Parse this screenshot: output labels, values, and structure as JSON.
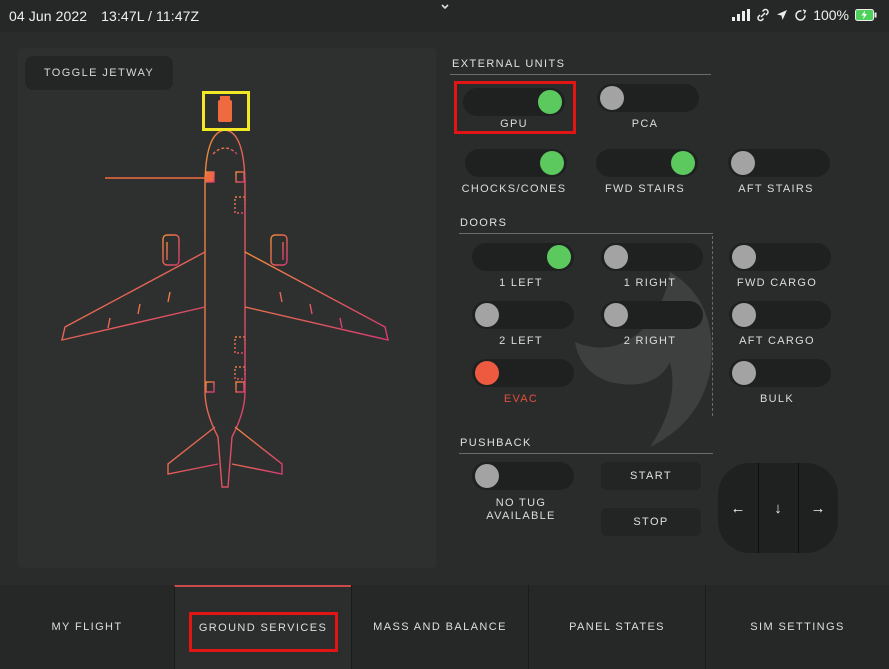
{
  "status_bar": {
    "date": "04 Jun 2022",
    "time": "13:47L / 11:47Z",
    "battery": "100%",
    "icons": [
      "cellular-signal-icon",
      "link-icon",
      "location-arrow-icon",
      "sync-icon",
      "battery-charging-icon"
    ]
  },
  "jetway": {
    "button_label": "TOGGLE JETWAY"
  },
  "external_units": {
    "title": "EXTERNAL UNITS",
    "items": [
      {
        "label": "GPU",
        "state": "on"
      },
      {
        "label": "PCA",
        "state": "off"
      },
      {
        "label": "CHOCKS/CONES",
        "state": "on"
      },
      {
        "label": "FWD STAIRS",
        "state": "on"
      },
      {
        "label": "AFT STAIRS",
        "state": "off"
      }
    ]
  },
  "doors": {
    "title": "DOORS",
    "items": [
      {
        "label": "1 LEFT",
        "state": "on"
      },
      {
        "label": "1 RIGHT",
        "state": "off"
      },
      {
        "label": "FWD CARGO",
        "state": "off"
      },
      {
        "label": "2 LEFT",
        "state": "off"
      },
      {
        "label": "2 RIGHT",
        "state": "off"
      },
      {
        "label": "AFT CARGO",
        "state": "off"
      },
      {
        "label": "EVAC",
        "state": "alert"
      },
      {
        "label": "BULK",
        "state": "off"
      }
    ]
  },
  "pushback": {
    "title": "PUSHBACK",
    "tug_label_line1": "NO TUG",
    "tug_label_line2": "AVAILABLE",
    "tug_state": "off",
    "start_label": "START",
    "stop_label": "STOP",
    "left_arrow": "←",
    "down_arrow": "↓",
    "right_arrow": "→"
  },
  "tabs": [
    {
      "label": "MY FLIGHT",
      "active": false
    },
    {
      "label": "GROUND SERVICES",
      "active": true
    },
    {
      "label": "MASS AND BALANCE",
      "active": false
    },
    {
      "label": "PANEL STATES",
      "active": false
    },
    {
      "label": "SIM SETTINGS",
      "active": false
    }
  ],
  "colors": {
    "on": "#5cc95e",
    "off": "#a3a3a3",
    "evac": "#ee5a40",
    "highlight_red": "#e21414",
    "highlight_yellow": "#f3e825"
  }
}
